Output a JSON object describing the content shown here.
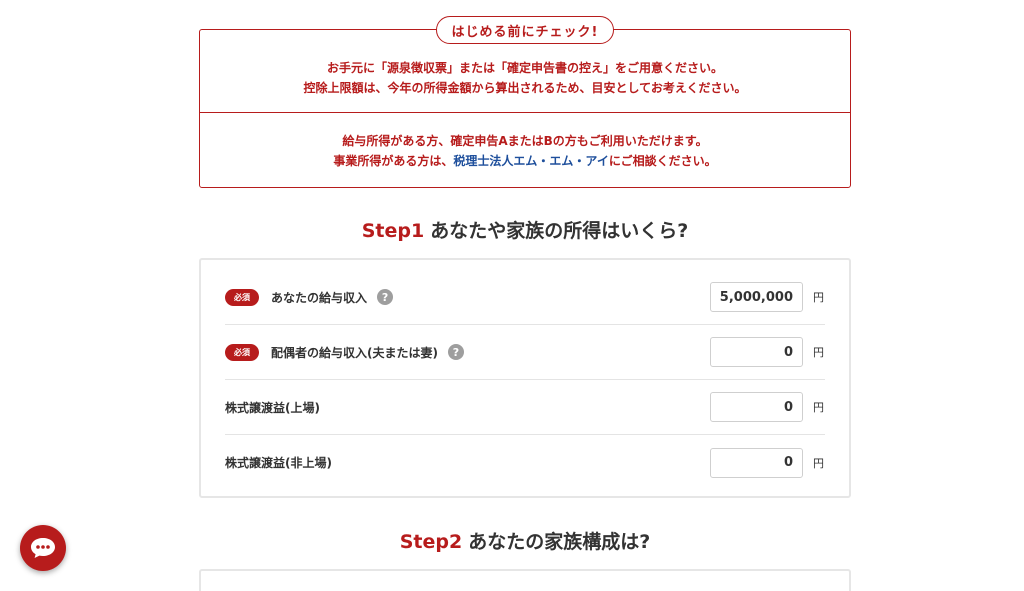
{
  "notice": {
    "tag": "はじめる前にチェック!",
    "line1": "お手元に「源泉徴収票」または「確定申告書の控え」をご用意ください。",
    "line2": "控除上限額は、今年の所得金額から算出されるため、目安としてお考えください。",
    "line3": "給与所得がある方、確定申告AまたはBの方もご利用いただけます。",
    "line4_pre": "事業所得がある方は、",
    "line4_link": "税理士法人エム・エム・アイ",
    "line4_post": "にご相談ください。"
  },
  "step1": {
    "label": "Step1",
    "title": "あなたや家族の所得はいくら?"
  },
  "form": {
    "required_badge": "必須",
    "help_mark": "?",
    "unit": "円",
    "rows": [
      {
        "label": "あなたの給与収入",
        "value": "5,000,000"
      },
      {
        "label": "配偶者の給与収入(夫または妻)",
        "value": "0"
      },
      {
        "label": "株式譲渡益(上場)",
        "value": "0"
      },
      {
        "label": "株式譲渡益(非上場)",
        "value": "0"
      }
    ]
  },
  "step2": {
    "label": "Step2",
    "title": "あなたの家族構成は?"
  },
  "chat": {
    "icon": "chat-bubble-icon"
  },
  "colors": {
    "accent": "#b71c1c",
    "link": "#1e4f9c",
    "help": "#9e9e9e"
  }
}
